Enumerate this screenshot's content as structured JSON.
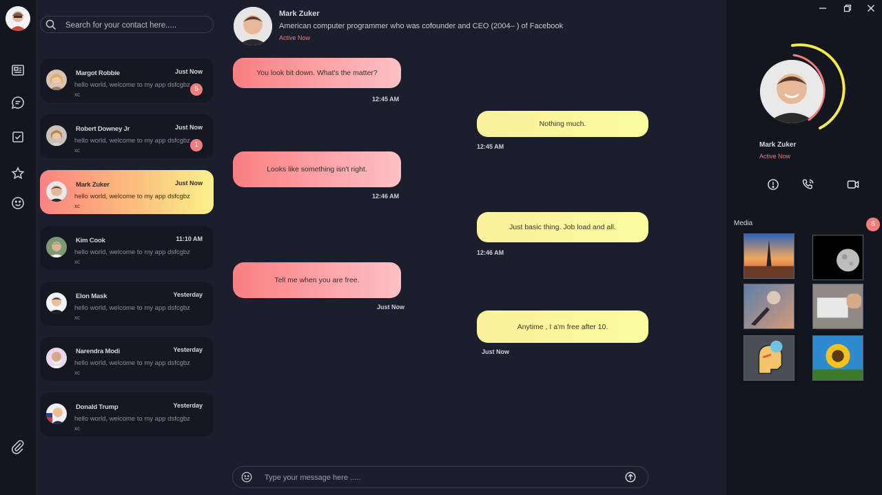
{
  "search": {
    "placeholder": "Search for your contact here....."
  },
  "contacts": [
    {
      "name": "Margot Robbie",
      "time": "Just Now",
      "message": "hello world, welcome to my app dsfcgbz",
      "sub": "xc",
      "badge": "5"
    },
    {
      "name": "Robert Downey Jr",
      "time": "Just Now",
      "message": "hello world, welcome to my app dsfcgbz",
      "sub": "xc",
      "badge": "1"
    },
    {
      "name": "Mark Zuker",
      "time": "Just Now",
      "message": "hello world, welcome to my app dsfcgbz",
      "sub": "xc",
      "badge": ""
    },
    {
      "name": "Kim Cook",
      "time": "11:10 AM",
      "message": "hello world, welcome to my app dsfcgbz",
      "sub": "xc",
      "badge": ""
    },
    {
      "name": "Elon Mask",
      "time": "Yesterday",
      "message": "hello world, welcome to my app dsfcgbz",
      "sub": "xc",
      "badge": ""
    },
    {
      "name": "Narendra Modi",
      "time": "Yesterday",
      "message": "hello world, welcome to my app dsfcgbz",
      "sub": "xc",
      "badge": ""
    },
    {
      "name": "Donald Trump",
      "time": "Yesterday",
      "message": "hello world, welcome to my app dsfcgbz",
      "sub": "xc",
      "badge": ""
    }
  ],
  "chat": {
    "name": "Mark Zuker",
    "description": "American computer programmer who was cofounder and CEO (2004– ) of Facebook",
    "status": "Active Now",
    "messages": [
      {
        "direction": "in",
        "text": "You look bit down. What's the matter?",
        "time": "12:45 AM"
      },
      {
        "direction": "out",
        "text": "Nothing much.",
        "time": "12:45 AM"
      },
      {
        "direction": "in",
        "text": "Looks like something isn't right.",
        "time": "12:46 AM"
      },
      {
        "direction": "out",
        "text": "Just basic thing. Job load and all.",
        "time": "12:46 AM"
      },
      {
        "direction": "in",
        "text": "Tell me when you are free.",
        "time": "Just Now"
      },
      {
        "direction": "out",
        "text": "Anytime , I a'm free after 10.",
        "time": "Just Now"
      }
    ],
    "composer_placeholder": "Type your message here ....."
  },
  "profile": {
    "name": "Mark Zuker",
    "status": "Active Now",
    "media_label": "Media",
    "media_count": "6",
    "media": [
      "eiffel-tower-sunset",
      "full-moon",
      "hand-sparkles",
      "keyboard-hand",
      "face-sticker",
      "sunflower"
    ]
  },
  "icons": {
    "rail": [
      "newspaper-icon",
      "chat-bubble-icon",
      "checkbox-icon",
      "star-icon",
      "smiley-icon",
      "paperclip-icon"
    ],
    "actions": [
      "info-alert-icon",
      "phone-call-icon",
      "video-call-icon"
    ]
  },
  "colors": {
    "accent_red": "#f37878",
    "incoming_gradient": [
      "#fa7f82",
      "#fdc1c5"
    ],
    "outgoing_bubble": "#fafb9f",
    "active_card_gradient": [
      "#fb8282",
      "#f9f18a"
    ]
  }
}
